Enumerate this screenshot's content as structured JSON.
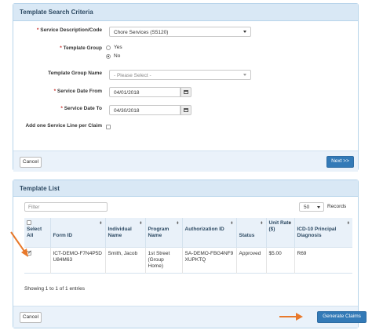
{
  "criteria": {
    "title": "Template Search Criteria",
    "service_desc": {
      "label": "Service Description/Code",
      "value": "Chore Services (S5120)"
    },
    "template_group": {
      "label": "Template Group",
      "opt_yes": "Yes",
      "opt_no": "No",
      "selected": "No"
    },
    "template_group_name": {
      "label": "Template Group Name",
      "placeholder": "- Please Select -"
    },
    "date_from": {
      "label": "Service Date From",
      "value": "04/01/2018"
    },
    "date_to": {
      "label": "Service Date To",
      "value": "04/30/2018"
    },
    "one_line": {
      "label": "Add one Service Line per Claim",
      "checked": false
    },
    "cancel_label": "Cancel",
    "next_label": "Next >>"
  },
  "list": {
    "title": "Template List",
    "filter_placeholder": "Filter",
    "records_value": "50",
    "records_label": "Records",
    "columns": [
      {
        "key": "select",
        "label": "Select All"
      },
      {
        "key": "form_id",
        "label": "Form ID"
      },
      {
        "key": "name",
        "label": "Individual Name"
      },
      {
        "key": "program",
        "label": "Program Name"
      },
      {
        "key": "auth",
        "label": "Authorization ID"
      },
      {
        "key": "status",
        "label": "Status"
      },
      {
        "key": "rate",
        "label": "Unit Rate ($)"
      },
      {
        "key": "icd",
        "label": "ICD-10 Principal Diagnosis"
      }
    ],
    "rows": [
      {
        "checked": true,
        "form_id": "ICT-DEMO-F7N4P5DU84M63",
        "name": "Smith, Jacob",
        "program": "1st Street (Group Home)",
        "auth": "SA-DEMO-FBG4NF9XUPKTQ",
        "status": "Approved",
        "rate": "$5.00",
        "icd": "R69"
      }
    ],
    "showing": "Showing 1 to 1 of 1 entries",
    "cancel_label": "Cancel",
    "generate_label": "Generate Claims"
  },
  "colors": {
    "accent": "#337ab7",
    "arrow": "#e8792b",
    "header_bg": "#d9e8f5"
  }
}
